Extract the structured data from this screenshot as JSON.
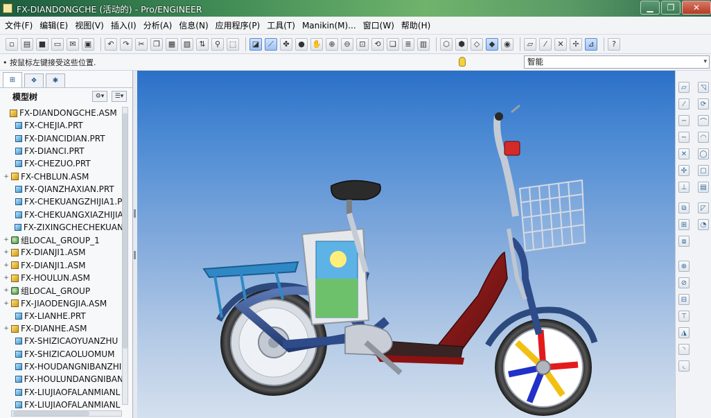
{
  "window": {
    "title": "FX-DIANDONGCHE (活动的) - Pro/ENGINEER",
    "controls": {
      "minimize": "▁",
      "maximize": "❐",
      "close": "✕"
    }
  },
  "menu": [
    "文件(F)",
    "编辑(E)",
    "视图(V)",
    "插入(I)",
    "分析(A)",
    "信息(N)",
    "应用程序(P)",
    "工具(T)",
    "Manikin(M)...",
    "窗口(W)",
    "帮助(H)"
  ],
  "status": {
    "message": "• 按鼠标左键接受这些位置.",
    "filter_value": "智能",
    "filter_arrow": "▾"
  },
  "left_panel": {
    "tabs": [
      "⊞",
      "❖",
      "✱"
    ],
    "header": "模型树",
    "tools": [
      "⚙▾",
      "☰▾"
    ]
  },
  "model_tree": [
    {
      "label": "FX-DIANDONGCHE.ASM",
      "kind": "root",
      "expander": ""
    },
    {
      "label": "FX-CHEJIA.PRT",
      "kind": "part",
      "expander": ""
    },
    {
      "label": "FX-DIANCIDIAN.PRT",
      "kind": "part",
      "expander": ""
    },
    {
      "label": "FX-DIANCI.PRT",
      "kind": "part",
      "expander": ""
    },
    {
      "label": "FX-CHEZUO.PRT",
      "kind": "part",
      "expander": ""
    },
    {
      "label": "FX-CHBLUN.ASM",
      "kind": "asm",
      "expander": "+"
    },
    {
      "label": "FX-QIANZHAXIAN.PRT",
      "kind": "part",
      "expander": ""
    },
    {
      "label": "FX-CHEKUANGZHIJIA1.P",
      "kind": "part",
      "expander": ""
    },
    {
      "label": "FX-CHEKUANGXIAZHIJIA",
      "kind": "part",
      "expander": ""
    },
    {
      "label": "FX-ZIXINGCHECHEKUAN",
      "kind": "part",
      "expander": ""
    },
    {
      "label": "组LOCAL_GROUP_1",
      "kind": "group",
      "expander": "+"
    },
    {
      "label": "FX-DIANJI1.ASM",
      "kind": "asm",
      "expander": "+"
    },
    {
      "label": "FX-DIANJI1.ASM",
      "kind": "asm",
      "expander": "+"
    },
    {
      "label": "FX-HOULUN.ASM",
      "kind": "asm",
      "expander": "+"
    },
    {
      "label": "组LOCAL_GROUP",
      "kind": "group",
      "expander": "+"
    },
    {
      "label": "FX-JIAODENGJIA.ASM",
      "kind": "asm",
      "expander": "+"
    },
    {
      "label": "FX-LIANHE.PRT",
      "kind": "part",
      "expander": ""
    },
    {
      "label": "FX-DIANHE.ASM",
      "kind": "asm",
      "expander": "+"
    },
    {
      "label": "FX-SHIZICAOYUANZHU",
      "kind": "part",
      "expander": ""
    },
    {
      "label": "FX-SHIZICAOLUOMUM",
      "kind": "part",
      "expander": ""
    },
    {
      "label": "FX-HOUDANGNIBANZHI",
      "kind": "part",
      "expander": ""
    },
    {
      "label": "FX-HOULUNDANGNIBAN",
      "kind": "part",
      "expander": ""
    },
    {
      "label": "FX-LIUJIAOFALANMIANL",
      "kind": "part",
      "expander": ""
    },
    {
      "label": "FX-LIUJIAOFALANMIANL",
      "kind": "part",
      "expander": ""
    }
  ],
  "colors": {
    "title_bar": "#3f8a55",
    "viewport_top": "#2b70c8",
    "viewport_bottom": "#d4e0ee",
    "frame": "#2e4b8a",
    "fender": "#7d1818"
  }
}
